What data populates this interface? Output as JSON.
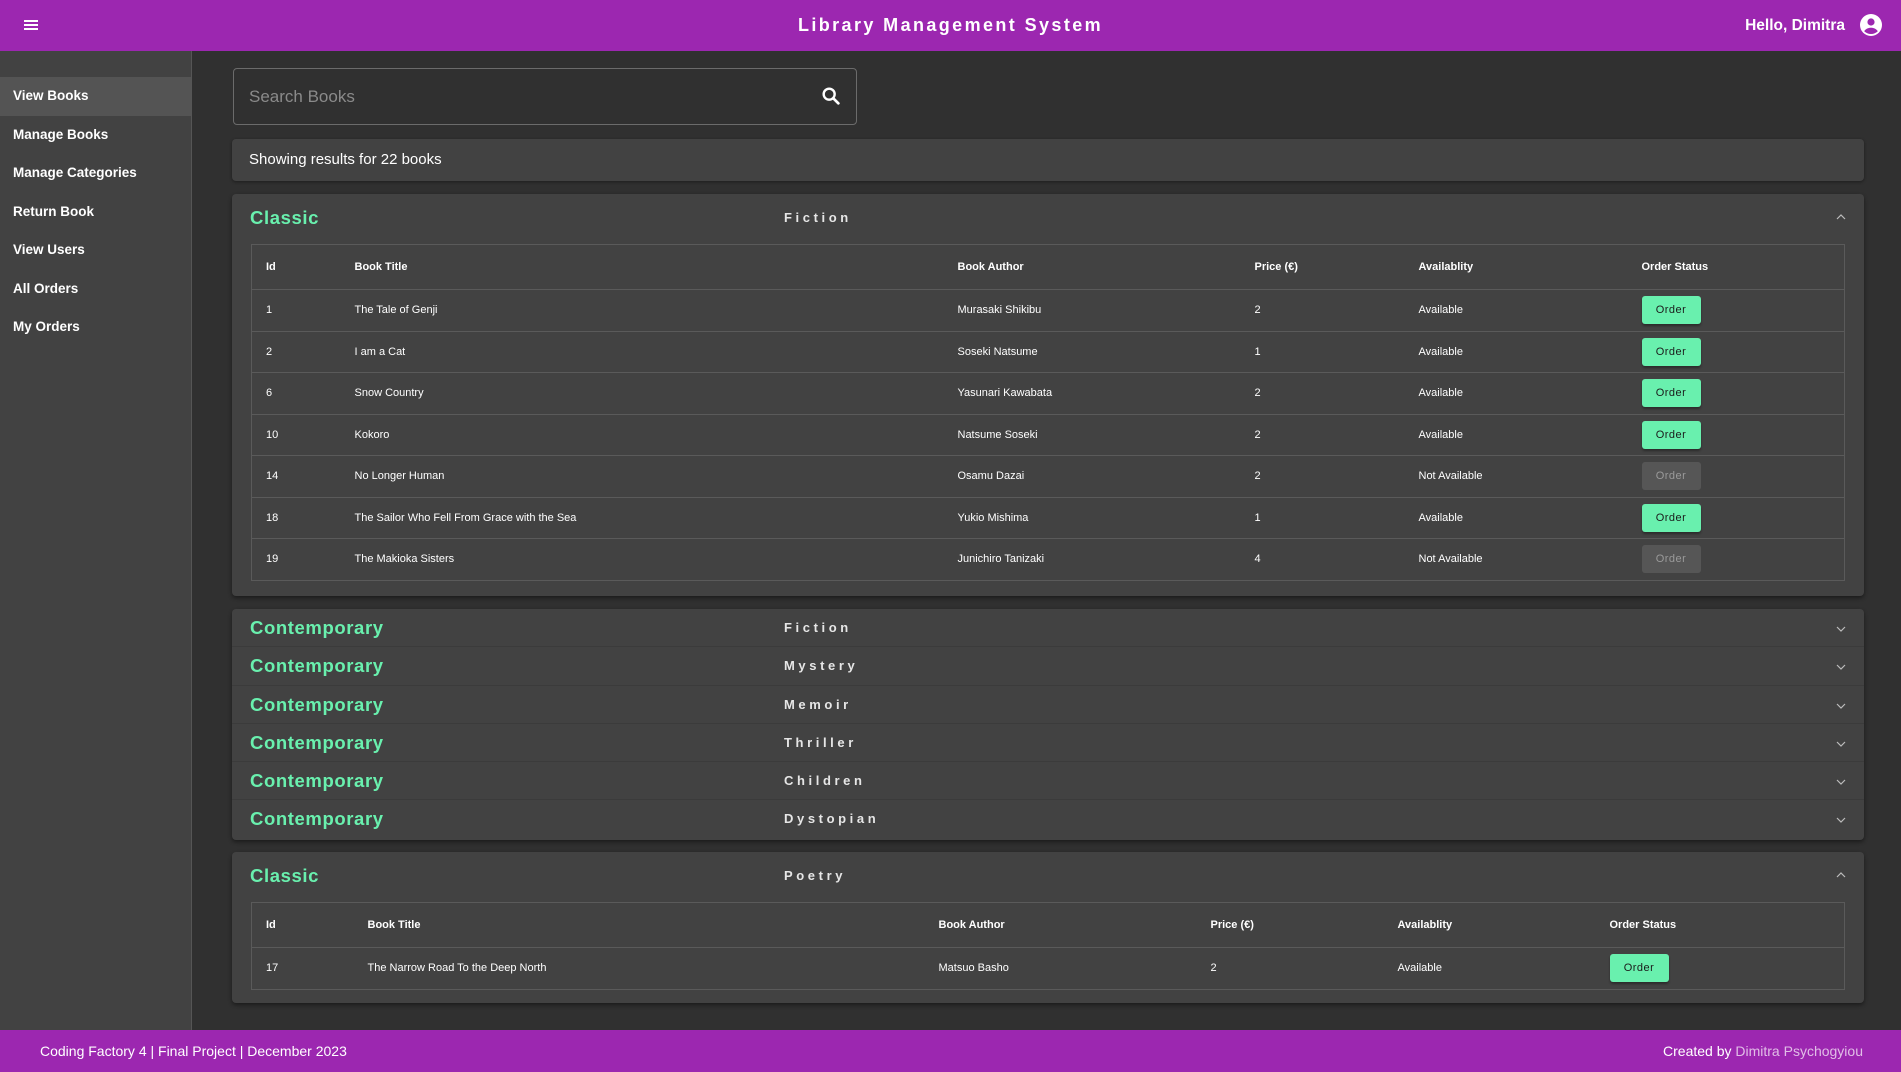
{
  "header": {
    "title": "Library Management System",
    "greeting": "Hello, Dimitra",
    "menu_icon": "menu-icon",
    "account_icon": "account-circle-icon"
  },
  "sidebar": {
    "items": [
      {
        "label": "View Books",
        "active": true
      },
      {
        "label": "Manage Books",
        "active": false
      },
      {
        "label": "Manage Categories",
        "active": false
      },
      {
        "label": "Return Book",
        "active": false
      },
      {
        "label": "View Users",
        "active": false
      },
      {
        "label": "All Orders",
        "active": false
      },
      {
        "label": "My Orders",
        "active": false
      }
    ]
  },
  "search": {
    "placeholder": "Search Books",
    "value": "",
    "icon": "search-icon"
  },
  "results": {
    "text": "Showing results for 22 books"
  },
  "colors": {
    "primary": "#9c27b0",
    "accent": "#69f0ae",
    "background": "#303030",
    "surface": "#424242"
  },
  "table_columns": [
    "Id",
    "Book Title",
    "Book Author",
    "Price (€)",
    "Availablity",
    "Order Status"
  ],
  "button_label": "Order",
  "categories": [
    {
      "category": "Classic",
      "genre": "Fiction",
      "expanded": true,
      "books": [
        {
          "id": "1",
          "title": "The Tale of Genji",
          "author": "Murasaki Shikibu",
          "price": "2",
          "availability": "Available",
          "orderable": true
        },
        {
          "id": "2",
          "title": "I am a Cat",
          "author": "Soseki Natsume",
          "price": "1",
          "availability": "Available",
          "orderable": true
        },
        {
          "id": "6",
          "title": "Snow Country",
          "author": "Yasunari Kawabata",
          "price": "2",
          "availability": "Available",
          "orderable": true
        },
        {
          "id": "10",
          "title": "Kokoro",
          "author": "Natsume Soseki",
          "price": "2",
          "availability": "Available",
          "orderable": true
        },
        {
          "id": "14",
          "title": "No Longer Human",
          "author": "Osamu Dazai",
          "price": "2",
          "availability": "Not Available",
          "orderable": false
        },
        {
          "id": "18",
          "title": "The Sailor Who Fell From Grace with the Sea",
          "author": "Yukio Mishima",
          "price": "1",
          "availability": "Available",
          "orderable": true
        },
        {
          "id": "19",
          "title": "The Makioka Sisters",
          "author": "Junichiro Tanizaki",
          "price": "4",
          "availability": "Not Available",
          "orderable": false
        }
      ]
    },
    {
      "category": "Contemporary",
      "genre": "Fiction",
      "expanded": false,
      "books": []
    },
    {
      "category": "Contemporary",
      "genre": "Mystery",
      "expanded": false,
      "books": []
    },
    {
      "category": "Contemporary",
      "genre": "Memoir",
      "expanded": false,
      "books": []
    },
    {
      "category": "Contemporary",
      "genre": "Thriller",
      "expanded": false,
      "books": []
    },
    {
      "category": "Contemporary",
      "genre": "Children",
      "expanded": false,
      "books": []
    },
    {
      "category": "Contemporary",
      "genre": "Dystopian",
      "expanded": false,
      "books": []
    },
    {
      "category": "Classic",
      "genre": "Poetry",
      "expanded": true,
      "books": [
        {
          "id": "17",
          "title": "The Narrow Road To the Deep North",
          "author": "Matsuo Basho",
          "price": "2",
          "availability": "Available",
          "orderable": true
        }
      ]
    }
  ],
  "footer": {
    "left": "Coding Factory 4 | Final Project | December 2023",
    "created_by": "Created by",
    "author": "Dimitra Psychogyiou"
  }
}
